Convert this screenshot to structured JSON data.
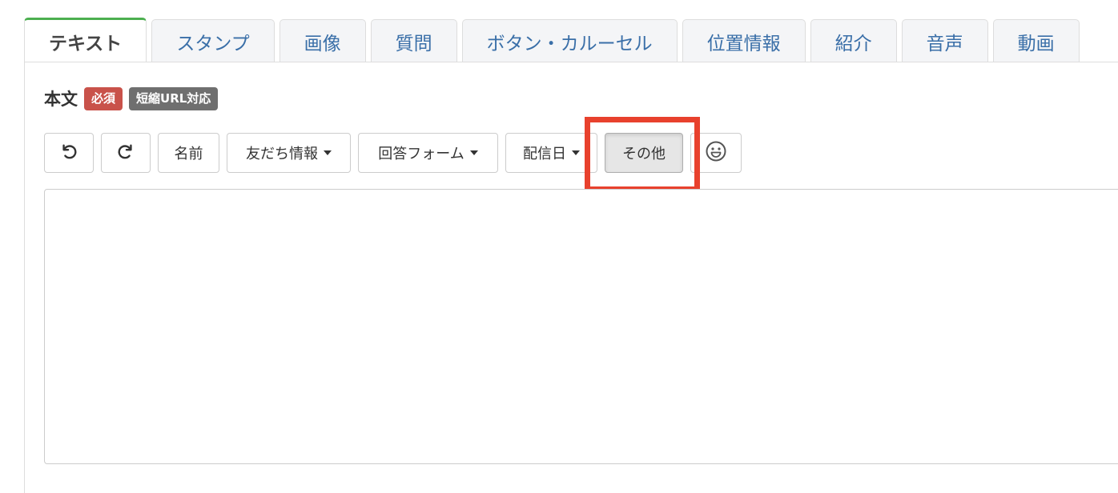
{
  "tabs": [
    {
      "label": "テキスト",
      "active": true
    },
    {
      "label": "スタンプ",
      "active": false
    },
    {
      "label": "画像",
      "active": false
    },
    {
      "label": "質問",
      "active": false
    },
    {
      "label": "ボタン・カルーセル",
      "active": false
    },
    {
      "label": "位置情報",
      "active": false
    },
    {
      "label": "紹介",
      "active": false
    },
    {
      "label": "音声",
      "active": false
    },
    {
      "label": "動画",
      "active": false
    }
  ],
  "field": {
    "label": "本文",
    "badges": [
      {
        "label": "必須",
        "color": "#c9524a"
      },
      {
        "label": "短縮URL対応",
        "color": "#6f6f6f"
      }
    ]
  },
  "toolbar": {
    "undo_icon": "undo-icon",
    "redo_icon": "redo-icon",
    "name_label": "名前",
    "friend_info_label": "友だち情報",
    "answer_form_label": "回答フォーム",
    "delivery_date_label": "配信日",
    "other_label": "その他",
    "emoji_icon": "smiley-icon"
  },
  "editor": {
    "value": "",
    "placeholder": ""
  },
  "colors": {
    "tab_link": "#3a6fa8",
    "active_tab_top": "#4caf50",
    "highlight": "#e8412d"
  }
}
